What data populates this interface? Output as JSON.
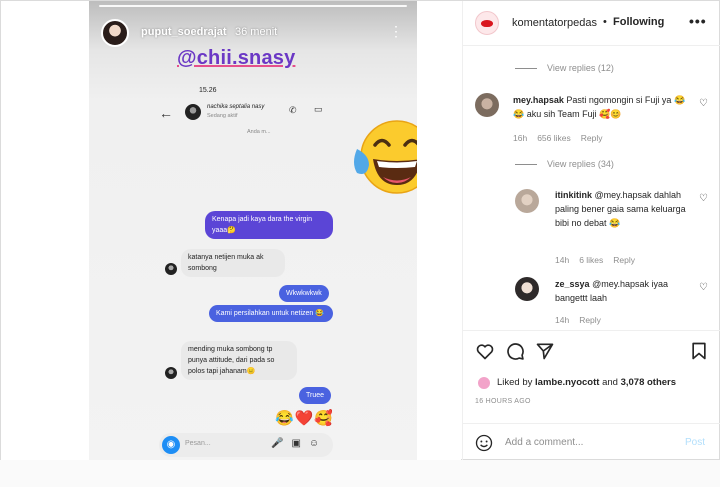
{
  "story": {
    "user": "puput_soedrajat",
    "time": "36 menit",
    "mention": "@chii.snasy",
    "status_time": "15.26",
    "chat_name": "nachika septalia nasy",
    "chat_sub": "Sedang aktif",
    "you_replied": "Anda m...",
    "messages": [
      {
        "dir": "out",
        "text": "Kenapa jadi kaya dara the virgin yaaa🤔"
      },
      {
        "dir": "in",
        "text": "katanya netijen muka ak sombong"
      },
      {
        "dir": "out",
        "text": "Wkwkwkwk"
      },
      {
        "dir": "out",
        "text": "Kami persilahkan untuk netizen 😂"
      },
      {
        "dir": "in",
        "text": "mending muka sombong tp punya attitude, dari pada so polos tapi jahanam😑"
      },
      {
        "dir": "out",
        "text": "Truee"
      }
    ],
    "reactions": "😂❤️🥰",
    "compose_placeholder": "Pesan..."
  },
  "post": {
    "author": "komentatorpedas",
    "follow_label": "Following",
    "comments": [
      {
        "type": "view_replies",
        "label": "View replies (12)"
      },
      {
        "type": "comment",
        "user": "mey.hapsak",
        "text": "Pasti ngomongin si Fuji ya 😂😂 aku sih Team Fuji 🥰😊",
        "time": "16h",
        "likes": "656 likes",
        "reply": "Reply"
      },
      {
        "type": "view_replies",
        "label": "View replies (34)"
      },
      {
        "type": "reply",
        "user": "itinkitink",
        "text": "@mey.hapsak dahlah paling bener gaia sama keluarga bibi no debat 😂",
        "time": "14h",
        "likes": "6 likes",
        "reply": "Reply"
      },
      {
        "type": "reply",
        "user": "ze_ssya",
        "text": "@mey.hapsak iyaa bangettt laah",
        "time": "14h",
        "reply": "Reply"
      }
    ],
    "liked_by_prefix": "Liked by",
    "liked_by_user": "lambe.nyocott",
    "liked_by_and": "and",
    "liked_by_count": "3,078 others",
    "timestamp": "16 HOURS AGO",
    "add_comment_placeholder": "Add a comment...",
    "post_label": "Post"
  }
}
